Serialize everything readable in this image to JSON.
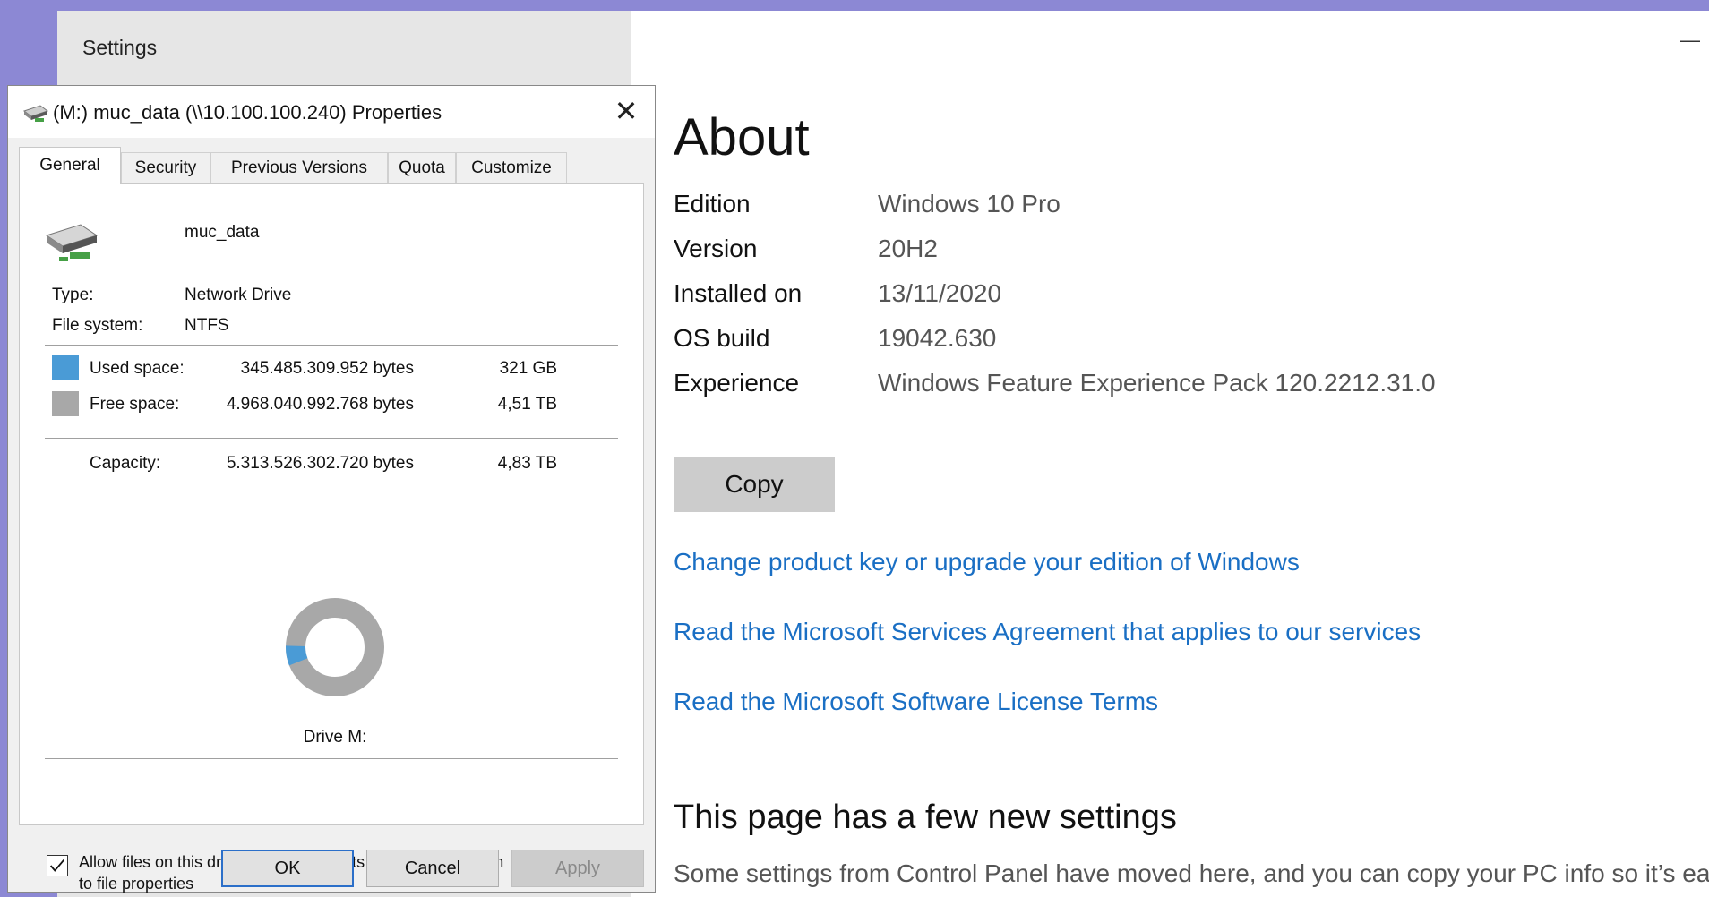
{
  "settings": {
    "window_title": "Settings",
    "minimize_glyph": "—",
    "about": {
      "title": "About",
      "specs": [
        {
          "label": "Edition",
          "value": "Windows 10 Pro"
        },
        {
          "label": "Version",
          "value": "20H2"
        },
        {
          "label": "Installed on",
          "value": "13/11/2020"
        },
        {
          "label": "OS build",
          "value": "19042.630"
        },
        {
          "label": "Experience",
          "value": "Windows Feature Experience Pack 120.2212.31.0"
        }
      ],
      "copy_label": "Copy",
      "links": [
        "Change product key or upgrade your edition of Windows",
        "Read the Microsoft Services Agreement that applies to our services",
        "Read the Microsoft Software License Terms"
      ],
      "new_settings_title": "This page has a few new settings",
      "new_settings_desc": "Some settings from Control Panel have moved here, and you can copy your PC info so it’s easi"
    }
  },
  "properties": {
    "title": "(M:) muc_data (\\\\10.100.100.240) Properties",
    "close_glyph": "✕",
    "tabs": [
      "General",
      "Security",
      "Previous Versions",
      "Quota",
      "Customize"
    ],
    "active_tab": "General",
    "drive_name": "muc_data",
    "type_label": "Type:",
    "type_value": "Network Drive",
    "fs_label": "File system:",
    "fs_value": "NTFS",
    "used": {
      "label": "Used space:",
      "bytes": "345.485.309.952 bytes",
      "size": "321 GB",
      "color": "#4a9bd6"
    },
    "free": {
      "label": "Free space:",
      "bytes": "4.968.040.992.768 bytes",
      "size": "4,51 TB",
      "color": "#a8a8a8"
    },
    "capacity": {
      "label": "Capacity:",
      "bytes": "5.313.526.302.720 bytes",
      "size": "4,83 TB"
    },
    "used_fraction": 0.065,
    "drive_label": "Drive M:",
    "index_checkbox": {
      "checked": true,
      "line1": "Allow files on this drive to have contents indexed in addition",
      "line2": "to file properties"
    },
    "buttons": {
      "ok": "OK",
      "cancel": "Cancel",
      "apply": "Apply"
    }
  }
}
